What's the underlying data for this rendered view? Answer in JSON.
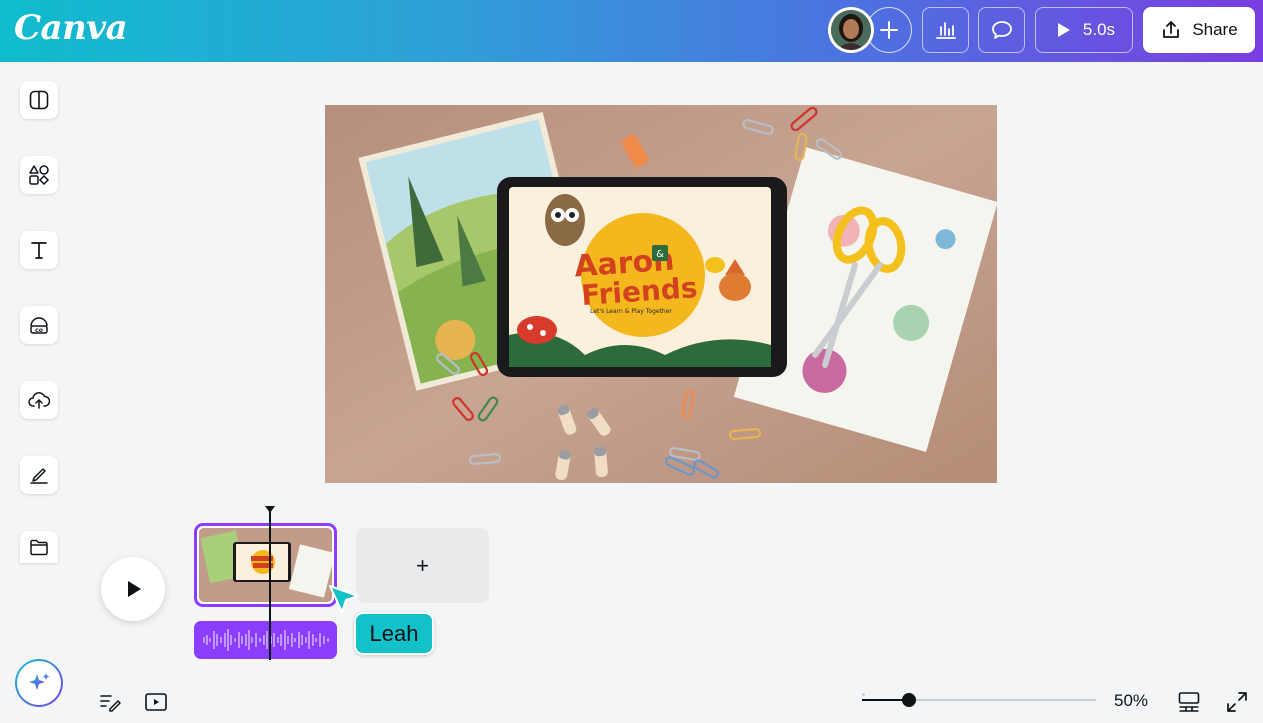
{
  "app": {
    "logo": "Canva",
    "brand_gradient": [
      "#0fbccd",
      "#7a3ee0"
    ]
  },
  "header": {
    "add_collaborator_icon": "plus-icon",
    "insights_icon": "bar-chart-icon",
    "comments_icon": "comment-icon",
    "present": {
      "icon": "play-icon",
      "label": "5.0s"
    },
    "share": {
      "icon": "share-upload-icon",
      "label": "Share"
    }
  },
  "sidebar": {
    "items": [
      {
        "name": "design",
        "icon": "layout-panel-icon"
      },
      {
        "name": "elements",
        "icon": "shapes-icon"
      },
      {
        "name": "text",
        "icon": "text-icon"
      },
      {
        "name": "brand",
        "icon": "brand-kit-icon"
      },
      {
        "name": "uploads",
        "icon": "cloud-upload-icon"
      },
      {
        "name": "draw",
        "icon": "pen-icon"
      },
      {
        "name": "projects",
        "icon": "folder-icon"
      }
    ],
    "magic_icon": "sparkle-icon"
  },
  "canvas": {
    "tablet_title_line1": "Aaron",
    "tablet_title_amp": "&",
    "tablet_title_line2": "Friends",
    "tablet_subtitle": "Let's Learn & Play Together"
  },
  "timeline": {
    "play_icon": "play-icon",
    "add_page_label": "+",
    "collaborator_cursor_name": "Leah",
    "cursor_color": "#13c2c9",
    "clip_border_color": "#8b3dff"
  },
  "footer": {
    "notes_icon": "notes-pen-icon",
    "present_icon": "present-screen-icon",
    "zoom_level": 50,
    "zoom_label": "50%",
    "grid_view_icon": "grid-view-icon",
    "fullscreen_icon": "expand-icon"
  }
}
